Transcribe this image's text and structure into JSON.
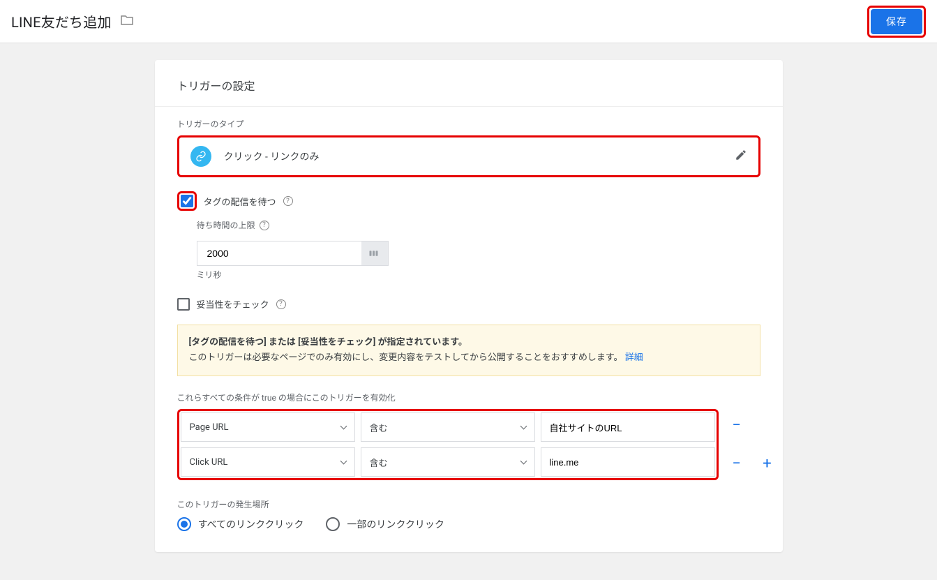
{
  "header": {
    "title": "LINE友だち追加",
    "save_label": "保存"
  },
  "card": {
    "title": "トリガーの設定",
    "trigger_type_label": "トリガーのタイプ",
    "trigger_type_value": "クリック - リンクのみ",
    "wait_for_tags_label": "タグの配信を待つ",
    "wait_for_tags_checked": true,
    "timeout_label": "待ち時間の上限",
    "timeout_value": "2000",
    "timeout_unit": "ミリ秒",
    "check_validation_label": "妥当性をチェック",
    "check_validation_checked": false,
    "info_bold": "[タグの配信を待つ] または [妥当性をチェック] が指定されています。",
    "info_text": "このトリガーは必要なページでのみ有効にし、変更内容をテストしてから公開することをおすすめします。",
    "info_link": "詳細",
    "conditions_label": "これらすべての条件が true の場合にこのトリガーを有効化",
    "conditions": [
      {
        "variable": "Page URL",
        "operator": "含む",
        "value": "自社サイトのURL"
      },
      {
        "variable": "Click URL",
        "operator": "含む",
        "value": "line.me"
      }
    ],
    "location_label": "このトリガーの発生場所",
    "location_options": {
      "all": "すべてのリンククリック",
      "some": "一部のリンククリック"
    },
    "location_selected": "all"
  }
}
